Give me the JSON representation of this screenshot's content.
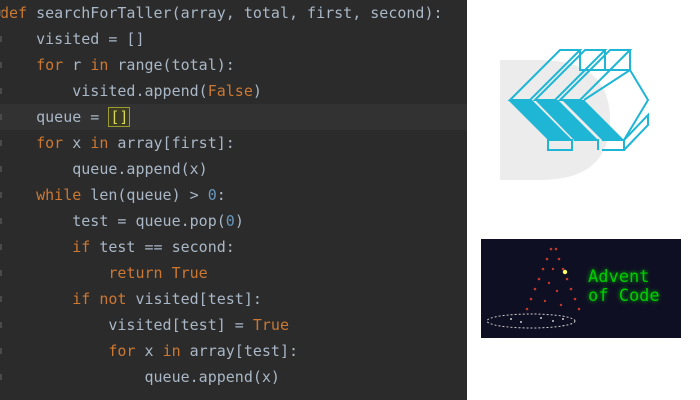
{
  "editor": {
    "lines": [
      {
        "tokens": [
          {
            "t": "def ",
            "c": "kw"
          },
          {
            "t": "searchForTaller",
            "c": "fn"
          },
          {
            "t": "(array, total, first, second):",
            "c": "p"
          }
        ]
      },
      {
        "tokens": [
          {
            "t": "    visited = []",
            "c": "p"
          }
        ]
      },
      {
        "tokens": [
          {
            "t": "    ",
            "c": "p"
          },
          {
            "t": "for",
            "c": "kw"
          },
          {
            "t": " r ",
            "c": "p"
          },
          {
            "t": "in",
            "c": "kw"
          },
          {
            "t": " range(total):",
            "c": "p"
          }
        ]
      },
      {
        "tokens": [
          {
            "t": "        visited.append(",
            "c": "p"
          },
          {
            "t": "False",
            "c": "bool"
          },
          {
            "t": ")",
            "c": "p"
          }
        ]
      },
      {
        "current": true,
        "tokens": [
          {
            "t": "    queue = ",
            "c": "p"
          },
          {
            "t": "[]",
            "c": "hl"
          }
        ]
      },
      {
        "tokens": [
          {
            "t": "    ",
            "c": "p"
          },
          {
            "t": "for",
            "c": "kw"
          },
          {
            "t": " x ",
            "c": "p"
          },
          {
            "t": "in",
            "c": "kw"
          },
          {
            "t": " array[first]:",
            "c": "p"
          }
        ]
      },
      {
        "tokens": [
          {
            "t": "        queue.append(x)",
            "c": "p"
          }
        ]
      },
      {
        "tokens": [
          {
            "t": "    ",
            "c": "p"
          },
          {
            "t": "while",
            "c": "kw"
          },
          {
            "t": " len(queue) > ",
            "c": "p"
          },
          {
            "t": "0",
            "c": "num"
          },
          {
            "t": ":",
            "c": "p"
          }
        ]
      },
      {
        "tokens": [
          {
            "t": "        test = queue.pop(",
            "c": "p"
          },
          {
            "t": "0",
            "c": "num"
          },
          {
            "t": ")",
            "c": "p"
          }
        ]
      },
      {
        "tokens": [
          {
            "t": "        ",
            "c": "p"
          },
          {
            "t": "if",
            "c": "kw"
          },
          {
            "t": " test == second:",
            "c": "p"
          }
        ]
      },
      {
        "tokens": [
          {
            "t": "            ",
            "c": "p"
          },
          {
            "t": "return",
            "c": "kw"
          },
          {
            "t": " ",
            "c": "p"
          },
          {
            "t": "True",
            "c": "bool"
          }
        ]
      },
      {
        "tokens": [
          {
            "t": "        ",
            "c": "p"
          },
          {
            "t": "if",
            "c": "kw"
          },
          {
            "t": " ",
            "c": "p"
          },
          {
            "t": "not",
            "c": "kw"
          },
          {
            "t": " visited[test]:",
            "c": "p"
          }
        ]
      },
      {
        "tokens": [
          {
            "t": "            visited[test] = ",
            "c": "p"
          },
          {
            "t": "True",
            "c": "bool"
          }
        ]
      },
      {
        "tokens": [
          {
            "t": "            ",
            "c": "p"
          },
          {
            "t": "for",
            "c": "kw"
          },
          {
            "t": " x ",
            "c": "p"
          },
          {
            "t": "in",
            "c": "kw"
          },
          {
            "t": " array[test]:",
            "c": "p"
          }
        ]
      },
      {
        "tokens": [
          {
            "t": "                queue.append(x)",
            "c": "p"
          }
        ]
      }
    ]
  },
  "colors": {
    "editor_bg": "#2b2b2b",
    "keyword": "#cc7832",
    "number": "#6897bb",
    "text": "#a9b7c6",
    "advent_green": "#00cc00",
    "logo_cyan": "#1fb6d6"
  },
  "logo": {
    "icon": "cube-stack-logo-icon"
  },
  "advent": {
    "line1": "Advent",
    "line2": "of Code",
    "icon": "christmas-tree-icon"
  }
}
